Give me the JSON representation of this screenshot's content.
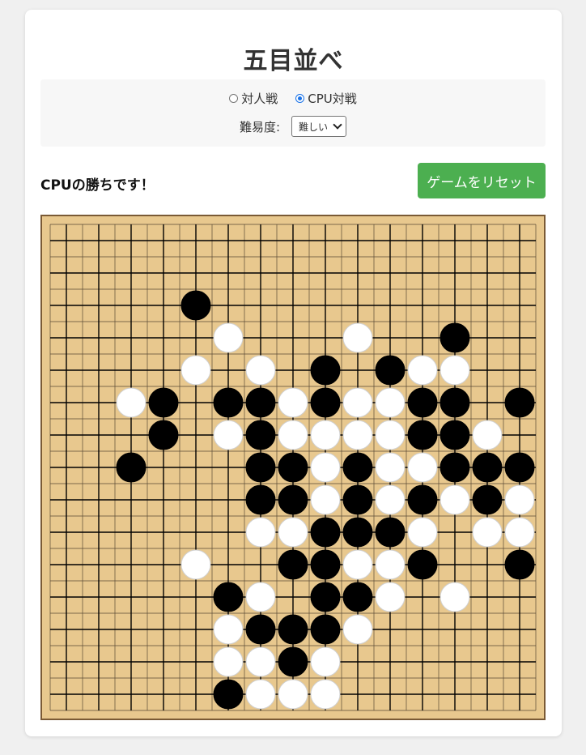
{
  "title": "五目並べ",
  "mode": {
    "options": [
      {
        "label": "対人戦",
        "checked": false
      },
      {
        "label": "CPU対戦",
        "checked": true
      }
    ]
  },
  "difficulty": {
    "label": "難易度:",
    "selected": "難しい"
  },
  "status": "CPUの勝ちです！",
  "reset_label": "ゲームをリセット",
  "colors": {
    "accent": "#4caf50",
    "board": "#e8c88e",
    "board_border": "#7a5a35",
    "black_stone": "#000000",
    "white_stone": "#ffffff"
  },
  "board": {
    "size": 15,
    "stones": [
      {
        "row": 2,
        "col": 4,
        "color": "black"
      },
      {
        "row": 3,
        "col": 5,
        "color": "white"
      },
      {
        "row": 3,
        "col": 9,
        "color": "white"
      },
      {
        "row": 3,
        "col": 12,
        "color": "black"
      },
      {
        "row": 4,
        "col": 4,
        "color": "white"
      },
      {
        "row": 4,
        "col": 6,
        "color": "white"
      },
      {
        "row": 4,
        "col": 8,
        "color": "black"
      },
      {
        "row": 4,
        "col": 10,
        "color": "black"
      },
      {
        "row": 4,
        "col": 11,
        "color": "white"
      },
      {
        "row": 4,
        "col": 12,
        "color": "white"
      },
      {
        "row": 5,
        "col": 2,
        "color": "white"
      },
      {
        "row": 5,
        "col": 3,
        "color": "black"
      },
      {
        "row": 5,
        "col": 5,
        "color": "black"
      },
      {
        "row": 5,
        "col": 6,
        "color": "black"
      },
      {
        "row": 5,
        "col": 7,
        "color": "white"
      },
      {
        "row": 5,
        "col": 8,
        "color": "black"
      },
      {
        "row": 5,
        "col": 9,
        "color": "white"
      },
      {
        "row": 5,
        "col": 10,
        "color": "white"
      },
      {
        "row": 5,
        "col": 11,
        "color": "black"
      },
      {
        "row": 5,
        "col": 12,
        "color": "black"
      },
      {
        "row": 5,
        "col": 14,
        "color": "black"
      },
      {
        "row": 6,
        "col": 3,
        "color": "black"
      },
      {
        "row": 6,
        "col": 5,
        "color": "white"
      },
      {
        "row": 6,
        "col": 6,
        "color": "black"
      },
      {
        "row": 6,
        "col": 7,
        "color": "white"
      },
      {
        "row": 6,
        "col": 8,
        "color": "white"
      },
      {
        "row": 6,
        "col": 9,
        "color": "white"
      },
      {
        "row": 6,
        "col": 10,
        "color": "white"
      },
      {
        "row": 6,
        "col": 11,
        "color": "black"
      },
      {
        "row": 6,
        "col": 12,
        "color": "black"
      },
      {
        "row": 6,
        "col": 13,
        "color": "white"
      },
      {
        "row": 7,
        "col": 2,
        "color": "black"
      },
      {
        "row": 7,
        "col": 6,
        "color": "black"
      },
      {
        "row": 7,
        "col": 7,
        "color": "black"
      },
      {
        "row": 7,
        "col": 8,
        "color": "white"
      },
      {
        "row": 7,
        "col": 9,
        "color": "black"
      },
      {
        "row": 7,
        "col": 10,
        "color": "white"
      },
      {
        "row": 7,
        "col": 11,
        "color": "white"
      },
      {
        "row": 7,
        "col": 12,
        "color": "black"
      },
      {
        "row": 7,
        "col": 13,
        "color": "black"
      },
      {
        "row": 7,
        "col": 14,
        "color": "black"
      },
      {
        "row": 8,
        "col": 6,
        "color": "black"
      },
      {
        "row": 8,
        "col": 7,
        "color": "black"
      },
      {
        "row": 8,
        "col": 8,
        "color": "white"
      },
      {
        "row": 8,
        "col": 9,
        "color": "black"
      },
      {
        "row": 8,
        "col": 10,
        "color": "white"
      },
      {
        "row": 8,
        "col": 11,
        "color": "black"
      },
      {
        "row": 8,
        "col": 12,
        "color": "white"
      },
      {
        "row": 8,
        "col": 13,
        "color": "black"
      },
      {
        "row": 8,
        "col": 14,
        "color": "white"
      },
      {
        "row": 9,
        "col": 6,
        "color": "white"
      },
      {
        "row": 9,
        "col": 7,
        "color": "white"
      },
      {
        "row": 9,
        "col": 8,
        "color": "black"
      },
      {
        "row": 9,
        "col": 9,
        "color": "black"
      },
      {
        "row": 9,
        "col": 10,
        "color": "black"
      },
      {
        "row": 9,
        "col": 11,
        "color": "white"
      },
      {
        "row": 9,
        "col": 13,
        "color": "white"
      },
      {
        "row": 9,
        "col": 14,
        "color": "white"
      },
      {
        "row": 10,
        "col": 4,
        "color": "white"
      },
      {
        "row": 10,
        "col": 7,
        "color": "black"
      },
      {
        "row": 10,
        "col": 8,
        "color": "black"
      },
      {
        "row": 10,
        "col": 9,
        "color": "white"
      },
      {
        "row": 10,
        "col": 10,
        "color": "white"
      },
      {
        "row": 10,
        "col": 11,
        "color": "black"
      },
      {
        "row": 10,
        "col": 14,
        "color": "black"
      },
      {
        "row": 11,
        "col": 5,
        "color": "black"
      },
      {
        "row": 11,
        "col": 6,
        "color": "white"
      },
      {
        "row": 11,
        "col": 8,
        "color": "black"
      },
      {
        "row": 11,
        "col": 9,
        "color": "black"
      },
      {
        "row": 11,
        "col": 10,
        "color": "white"
      },
      {
        "row": 11,
        "col": 12,
        "color": "white"
      },
      {
        "row": 12,
        "col": 5,
        "color": "white"
      },
      {
        "row": 12,
        "col": 6,
        "color": "black"
      },
      {
        "row": 12,
        "col": 7,
        "color": "black"
      },
      {
        "row": 12,
        "col": 8,
        "color": "black"
      },
      {
        "row": 12,
        "col": 9,
        "color": "white"
      },
      {
        "row": 13,
        "col": 5,
        "color": "white"
      },
      {
        "row": 13,
        "col": 6,
        "color": "white"
      },
      {
        "row": 13,
        "col": 7,
        "color": "black"
      },
      {
        "row": 13,
        "col": 8,
        "color": "white"
      },
      {
        "row": 14,
        "col": 5,
        "color": "black"
      },
      {
        "row": 14,
        "col": 6,
        "color": "white"
      },
      {
        "row": 14,
        "col": 7,
        "color": "white"
      },
      {
        "row": 14,
        "col": 8,
        "color": "white"
      }
    ]
  }
}
